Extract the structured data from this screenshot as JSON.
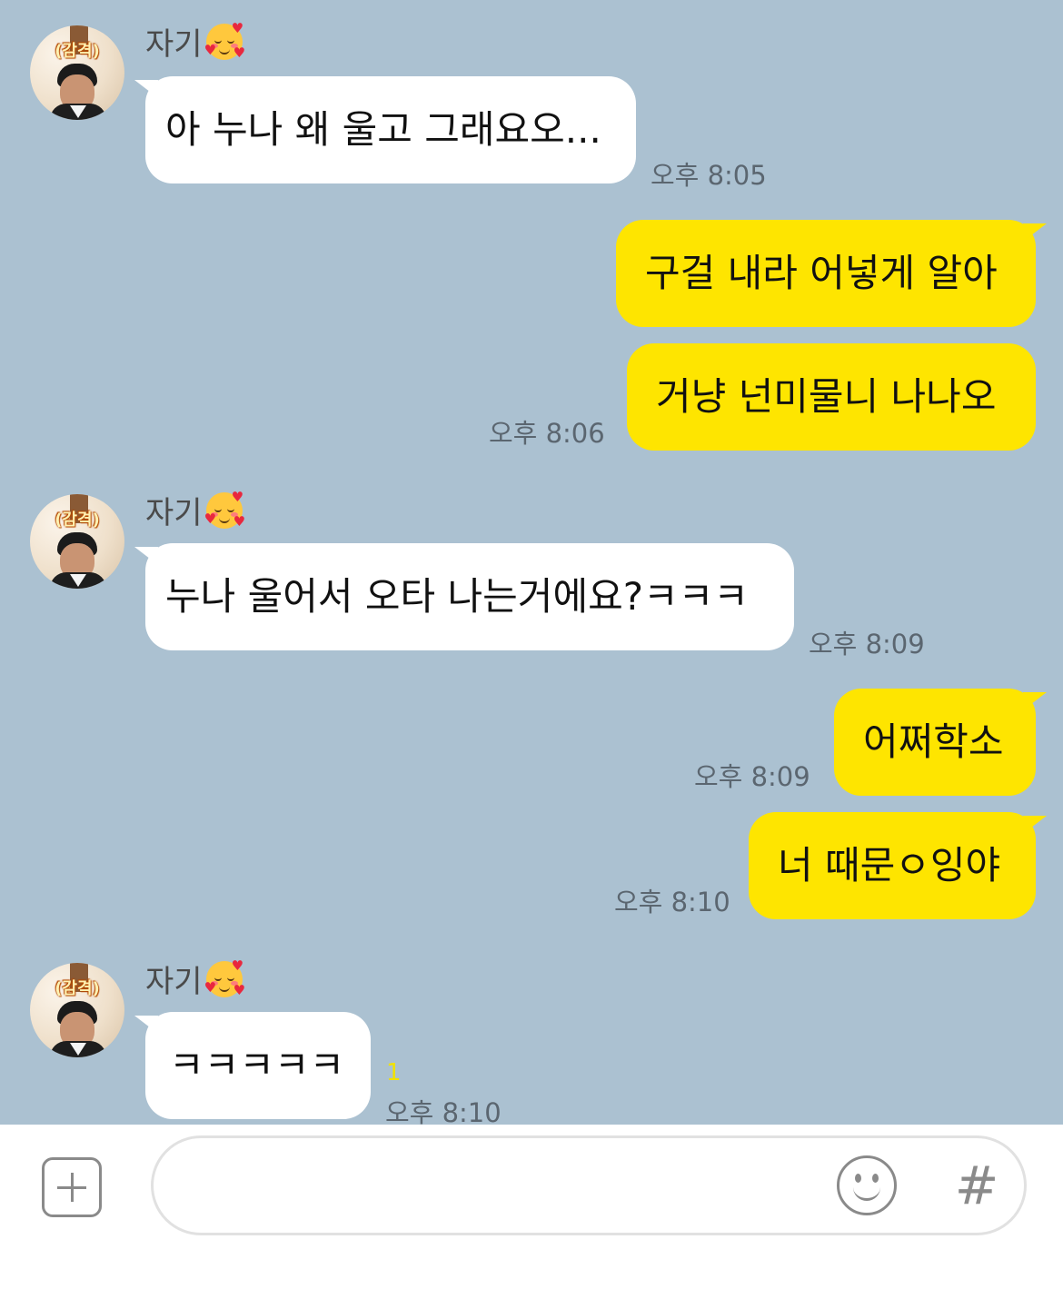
{
  "chat": {
    "partner_name": "자기",
    "partner_emoji": "smiling-face-with-hearts",
    "avatar_tag": "(감격)",
    "messages": [
      {
        "side": "in",
        "text": "아 누나 왜 울고 그래요오...",
        "time": "오후 8:05"
      },
      {
        "side": "out",
        "text": "구걸 내라 어넣게 알아",
        "time": ""
      },
      {
        "side": "out",
        "text": "거냥 넌미물니 나나오",
        "time": "오후 8:06"
      },
      {
        "side": "in",
        "text": "누나 울어서 오타 나는거에요?ㅋㅋㅋ",
        "time": "오후 8:09"
      },
      {
        "side": "out",
        "text": "어쩌학소",
        "time": "오후 8:09"
      },
      {
        "side": "out",
        "text": "너 때문ㅇ잉야",
        "time": "오후 8:10"
      },
      {
        "side": "in",
        "text": "ㅋㅋㅋㅋㅋ",
        "time": "오후 8:10",
        "unread": "1"
      }
    ]
  },
  "input_bar": {
    "plus_icon": "plus-icon",
    "message_value": "",
    "emoji_icon": "emoji-icon",
    "hash_label": "#"
  },
  "colors": {
    "chat_background": "#abc1d1",
    "incoming_bubble": "#ffffff",
    "outgoing_bubble": "#fee500",
    "unread_count": "#f1e200"
  }
}
